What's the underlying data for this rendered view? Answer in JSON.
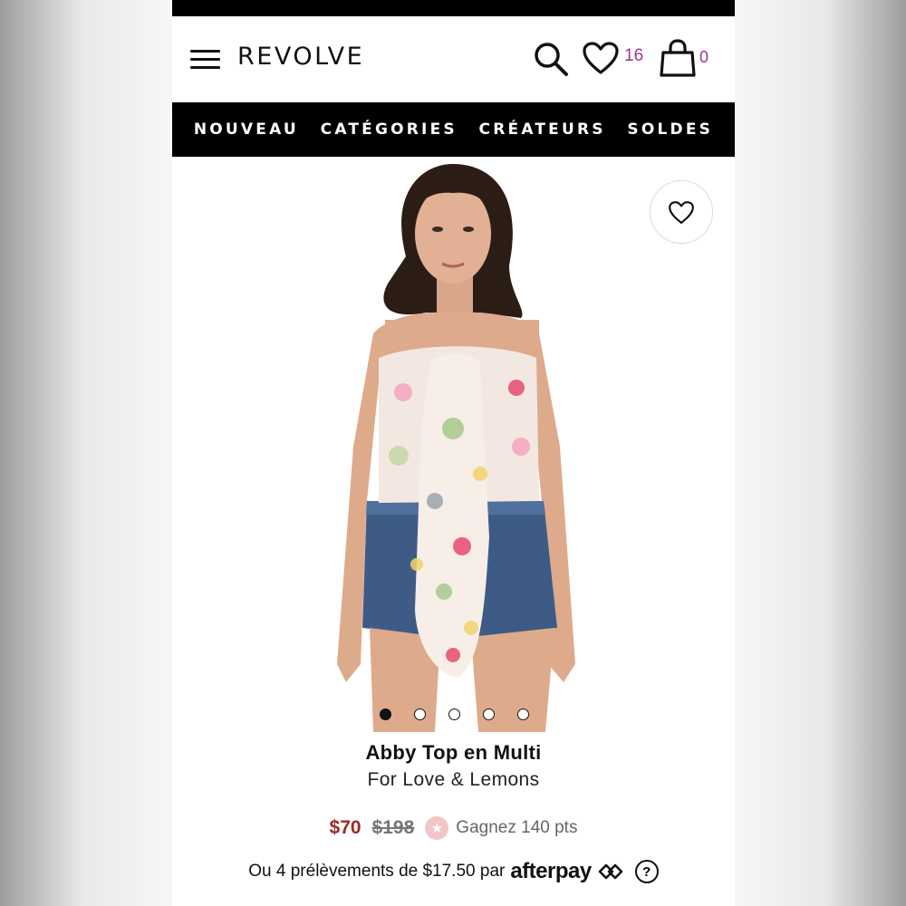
{
  "header": {
    "logo": "REVOLVE",
    "wishlist_count": "16",
    "bag_count": "0"
  },
  "nav": {
    "items": [
      "NOUVEAU",
      "CATÉGORIES",
      "CRÉATEURS",
      "SOLDES"
    ]
  },
  "gallery": {
    "image_count": 5,
    "active_index": 0
  },
  "product": {
    "title": "Abby Top en Multi",
    "brand": "For Love & Lemons",
    "sale_price": "$70",
    "original_price": "$198",
    "points_text": "Gagnez 140 pts",
    "installment_text": "Ou 4 prélèvements de $17.50 par",
    "installment_provider": "afterpay",
    "help_symbol": "?"
  },
  "colors": {
    "accent_count": "#a2338d",
    "sale_price": "#9b2a2a",
    "nav_background": "#000000"
  },
  "icons": [
    "menu-icon",
    "search-icon",
    "heart-icon",
    "bag-icon",
    "favorite-heart-icon",
    "star-icon",
    "afterpay-arrows-icon",
    "help-icon"
  ]
}
